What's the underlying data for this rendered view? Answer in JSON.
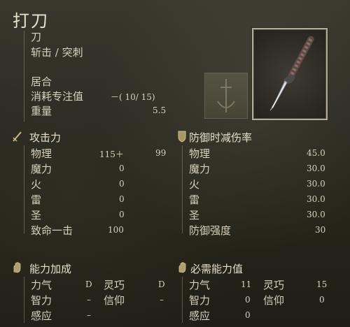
{
  "weapon": {
    "name": "打刀",
    "type": "刀",
    "damage_type": "斩击 / 突刺",
    "skill": "居合",
    "fp_label": "消耗专注值",
    "fp_value": "－( 10/ 15)",
    "weight_label": "重量",
    "weight_value": "5.5"
  },
  "attack": {
    "header": "攻击力",
    "rows": [
      {
        "label": "物理",
        "value": "115＋",
        "bonus": "99"
      },
      {
        "label": "魔力",
        "value": "0"
      },
      {
        "label": "火",
        "value": "0"
      },
      {
        "label": "雷",
        "value": "0"
      },
      {
        "label": "圣",
        "value": "0"
      },
      {
        "label": "致命一击",
        "value": "100"
      }
    ]
  },
  "guard": {
    "header": "防御时减伤率",
    "rows": [
      {
        "label": "物理",
        "value": "45.0"
      },
      {
        "label": "魔力",
        "value": "30.0"
      },
      {
        "label": "火",
        "value": "30.0"
      },
      {
        "label": "雷",
        "value": "30.0"
      },
      {
        "label": "圣",
        "value": "30.0"
      },
      {
        "label": "防御强度",
        "value": "30"
      }
    ]
  },
  "scaling": {
    "header": "能力加成",
    "rows": [
      {
        "l1": "力气",
        "v1": "D",
        "l2": "灵巧",
        "v2": "D"
      },
      {
        "l1": "智力",
        "v1": "–",
        "l2": "信仰",
        "v2": "–"
      },
      {
        "l1": "感应",
        "v1": "–"
      }
    ]
  },
  "requirements": {
    "header": "必需能力值",
    "rows": [
      {
        "l1": "力气",
        "v1": "11",
        "l2": "灵巧",
        "v2": "15"
      },
      {
        "l1": "智力",
        "v1": "0",
        "l2": "信仰",
        "v2": "0"
      },
      {
        "l1": "感应",
        "v1": "0"
      }
    ]
  },
  "icons": {
    "weapon_image": "uchigatana-katana-icon",
    "ash_of_war": "sword-emblem-icon",
    "attack_section": "sword-icon",
    "guard_section": "shield-icon",
    "scaling_section": "hand-icon",
    "requirements_section": "hand-icon"
  }
}
